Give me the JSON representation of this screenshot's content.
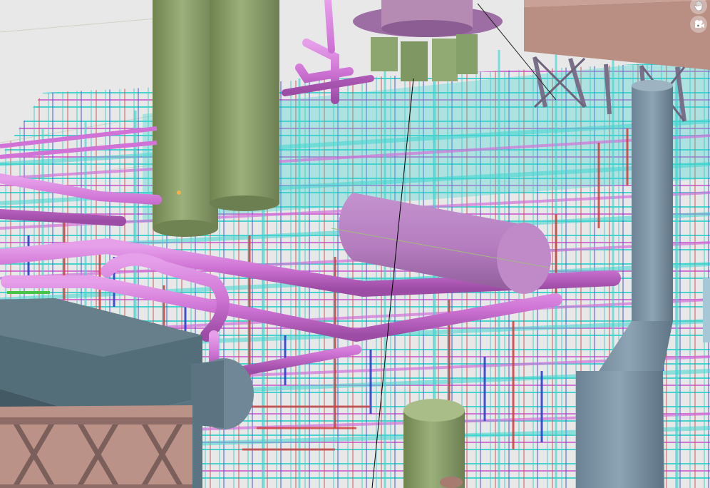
{
  "viewport": {
    "background": "#e7e7e7",
    "colors": {
      "pipe_magenta": "#d07ad6",
      "pipe_magenta_dark": "#a552ad",
      "pipe_cyan": "#3fd6d0",
      "pipe_red": "#d43b3b",
      "pipe_blue": "#2d3fd0",
      "pipe_green": "#47c447",
      "column_green": "#8ea46d",
      "column_green_dark": "#6e8252",
      "stack_gray": "#7f97a8",
      "stack_gray_dark": "#5d7383",
      "building_roof": "#5c7480",
      "building_side": "#3f555f",
      "structure_brown": "#b78d83",
      "truss": "#8b6f7c",
      "vessel_mauve": "#b07aa9"
    }
  },
  "controls": {
    "pan_icon": "hand-icon",
    "camera_icon": "camera-icon"
  }
}
